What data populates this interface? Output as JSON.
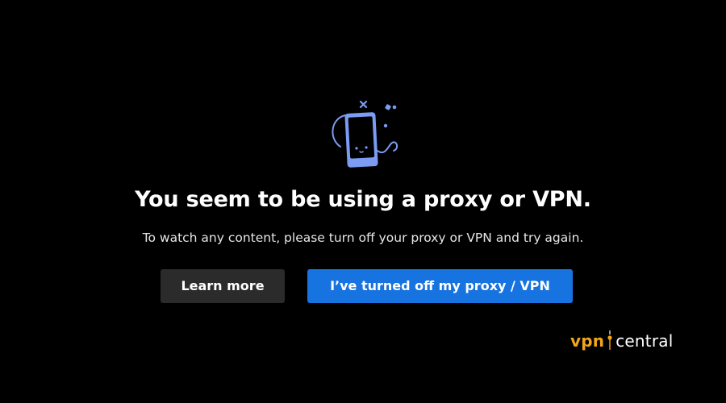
{
  "message": {
    "title": "You seem to be using a proxy or VPN.",
    "body": "To watch any content, please turn off your proxy or VPN and try again."
  },
  "actions": {
    "learn_more_label": "Learn more",
    "confirm_label": "I’ve turned off my proxy / VPN"
  },
  "illustration": {
    "icon": "phone-with-cord-icon",
    "color": "#7b9cf2"
  },
  "watermark": {
    "brand_left": "vpn",
    "brand_right": "central",
    "accent_color": "#f2a51a"
  },
  "colors": {
    "background": "#000000",
    "primary_button": "#1773e0",
    "secondary_button": "#2b2b2b"
  }
}
